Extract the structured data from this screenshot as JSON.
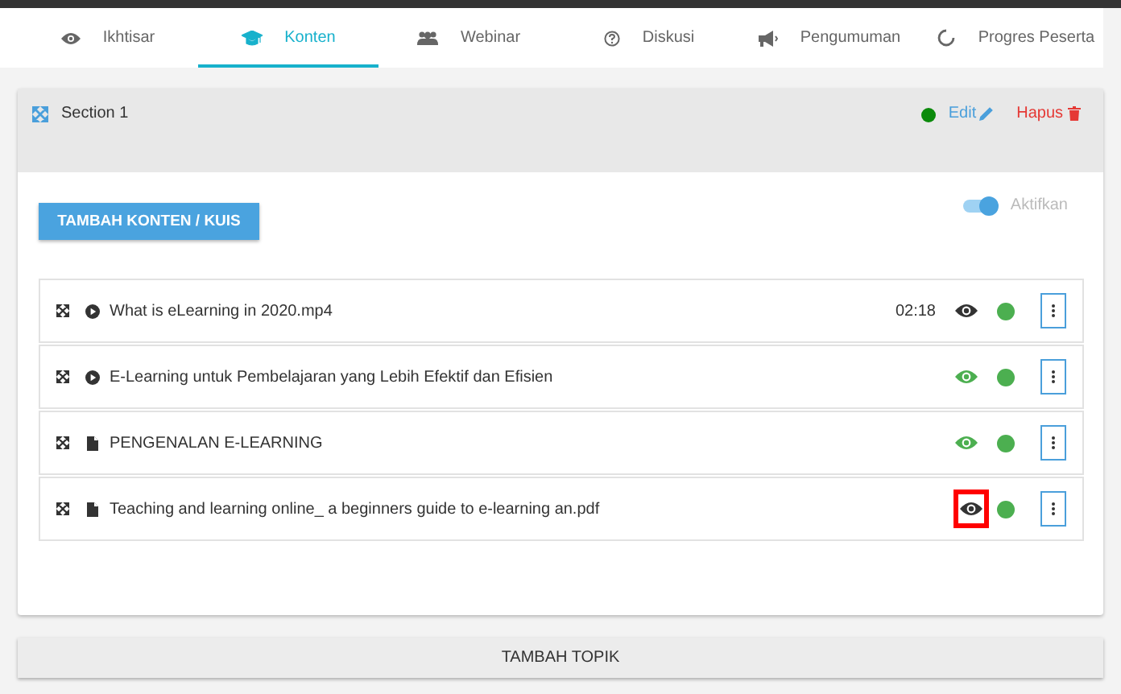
{
  "tabs": [
    {
      "label": "Ikhtisar",
      "selected": false
    },
    {
      "label": "Konten",
      "selected": true
    },
    {
      "label": "Webinar",
      "selected": false
    },
    {
      "label": "Diskusi",
      "selected": false
    },
    {
      "label": "Pengumuman",
      "selected": false
    },
    {
      "label": "Progres Peserta",
      "selected": false
    }
  ],
  "section": {
    "title": "Section 1",
    "color": "#0b8a0b",
    "edit_label": "Edit",
    "delete_label": "Hapus",
    "add_button": "TAMBAH KONTEN / KUIS",
    "active_toggle": {
      "label": "Aktifkan",
      "on": true
    },
    "items": [
      {
        "kind": "video",
        "title": "What is eLearning in 2020.mp4",
        "duration": "02:18",
        "visible": false,
        "highlighted": false,
        "color": "#4caf50"
      },
      {
        "kind": "video",
        "title": "E-Learning untuk Pembelajaran yang Lebih Efektif dan Efisien",
        "visible": true,
        "highlighted": false,
        "color": "#4caf50"
      },
      {
        "kind": "document",
        "title": "PENGENALAN E-LEARNING",
        "visible": true,
        "highlighted": false,
        "color": "#4caf50"
      },
      {
        "kind": "document",
        "title": "Teaching and learning online_ a beginners guide to e-learning an.pdf",
        "visible": false,
        "highlighted": true,
        "color": "#4caf50"
      }
    ]
  },
  "add_topic_button": "TAMBAH TOPIK"
}
